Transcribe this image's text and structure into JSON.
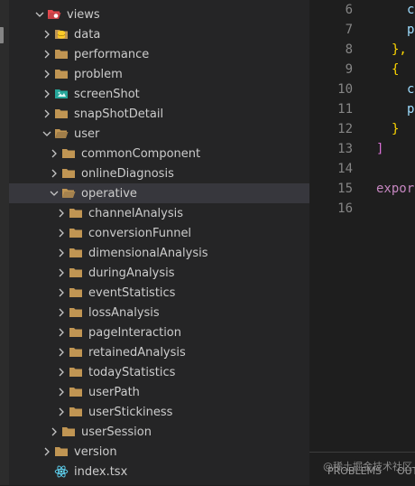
{
  "explorer": {
    "items": [
      {
        "label": "views",
        "depth": 0,
        "kind": "folder-special",
        "open": true,
        "chevron": "chevron-down"
      },
      {
        "label": "data",
        "depth": 1,
        "kind": "folder-db",
        "open": false,
        "chevron": "chevron-right"
      },
      {
        "label": "performance",
        "depth": 1,
        "kind": "folder",
        "open": false,
        "chevron": "chevron-right"
      },
      {
        "label": "problem",
        "depth": 1,
        "kind": "folder",
        "open": false,
        "chevron": "chevron-right"
      },
      {
        "label": "screenShot",
        "depth": 1,
        "kind": "folder-image",
        "open": false,
        "chevron": "chevron-right"
      },
      {
        "label": "snapShotDetail",
        "depth": 1,
        "kind": "folder",
        "open": false,
        "chevron": "chevron-right"
      },
      {
        "label": "user",
        "depth": 1,
        "kind": "folder",
        "open": true,
        "chevron": "chevron-down"
      },
      {
        "label": "commonComponent",
        "depth": 2,
        "kind": "folder",
        "open": false,
        "chevron": "chevron-right"
      },
      {
        "label": "onlineDiagnosis",
        "depth": 2,
        "kind": "folder",
        "open": false,
        "chevron": "chevron-right"
      },
      {
        "label": "operative",
        "depth": 2,
        "kind": "folder",
        "open": true,
        "chevron": "chevron-down",
        "selected": true
      },
      {
        "label": "channelAnalysis",
        "depth": 3,
        "kind": "folder",
        "open": false,
        "chevron": "chevron-right"
      },
      {
        "label": "conversionFunnel",
        "depth": 3,
        "kind": "folder",
        "open": false,
        "chevron": "chevron-right"
      },
      {
        "label": "dimensionalAnalysis",
        "depth": 3,
        "kind": "folder",
        "open": false,
        "chevron": "chevron-right"
      },
      {
        "label": "duringAnalysis",
        "depth": 3,
        "kind": "folder",
        "open": false,
        "chevron": "chevron-right"
      },
      {
        "label": "eventStatistics",
        "depth": 3,
        "kind": "folder",
        "open": false,
        "chevron": "chevron-right"
      },
      {
        "label": "lossAnalysis",
        "depth": 3,
        "kind": "folder",
        "open": false,
        "chevron": "chevron-right"
      },
      {
        "label": "pageInteraction",
        "depth": 3,
        "kind": "folder",
        "open": false,
        "chevron": "chevron-right"
      },
      {
        "label": "retainedAnalysis",
        "depth": 3,
        "kind": "folder",
        "open": false,
        "chevron": "chevron-right"
      },
      {
        "label": "todayStatistics",
        "depth": 3,
        "kind": "folder",
        "open": false,
        "chevron": "chevron-right"
      },
      {
        "label": "userPath",
        "depth": 3,
        "kind": "folder",
        "open": false,
        "chevron": "chevron-right"
      },
      {
        "label": "userStickiness",
        "depth": 3,
        "kind": "folder",
        "open": false,
        "chevron": "chevron-right"
      },
      {
        "label": "userSession",
        "depth": 2,
        "kind": "folder",
        "open": false,
        "chevron": "chevron-right"
      },
      {
        "label": "version",
        "depth": 1,
        "kind": "folder",
        "open": false,
        "chevron": "chevron-right"
      },
      {
        "label": "index.tsx",
        "depth": 1,
        "kind": "file-tsx",
        "open": false,
        "chevron": "none"
      }
    ]
  },
  "editor": {
    "lines": [
      {
        "num": "6",
        "text": "c",
        "color": "#9cdcfe",
        "indent": 2
      },
      {
        "num": "7",
        "text": "p",
        "color": "#9cdcfe",
        "indent": 2
      },
      {
        "num": "8",
        "text": "},",
        "color": "#ffd700",
        "indent": 1
      },
      {
        "num": "9",
        "text": "{",
        "color": "#ffd700",
        "indent": 1
      },
      {
        "num": "10",
        "text": "c",
        "color": "#9cdcfe",
        "indent": 2
      },
      {
        "num": "11",
        "text": "p",
        "color": "#9cdcfe",
        "indent": 2
      },
      {
        "num": "12",
        "text": "}",
        "color": "#ffd700",
        "indent": 1
      },
      {
        "num": "13",
        "text": "]",
        "color": "#da70d6",
        "indent": 0
      },
      {
        "num": "14",
        "text": "",
        "color": "#d4d4d4",
        "indent": 0
      },
      {
        "num": "15",
        "text": "expor",
        "color": "#c586c0",
        "indent": 0
      },
      {
        "num": "16",
        "text": "",
        "color": "#d4d4d4",
        "indent": 0
      }
    ]
  },
  "panel": {
    "tabs": [
      "PROBLEMS",
      "OUT"
    ]
  },
  "watermark": "@稀土掘金技术社区",
  "colors": {
    "folder": "#c09553",
    "folder_special": "#e5484d",
    "db": "#ffca28",
    "image": "#26a69a",
    "react": "#61dafb"
  }
}
